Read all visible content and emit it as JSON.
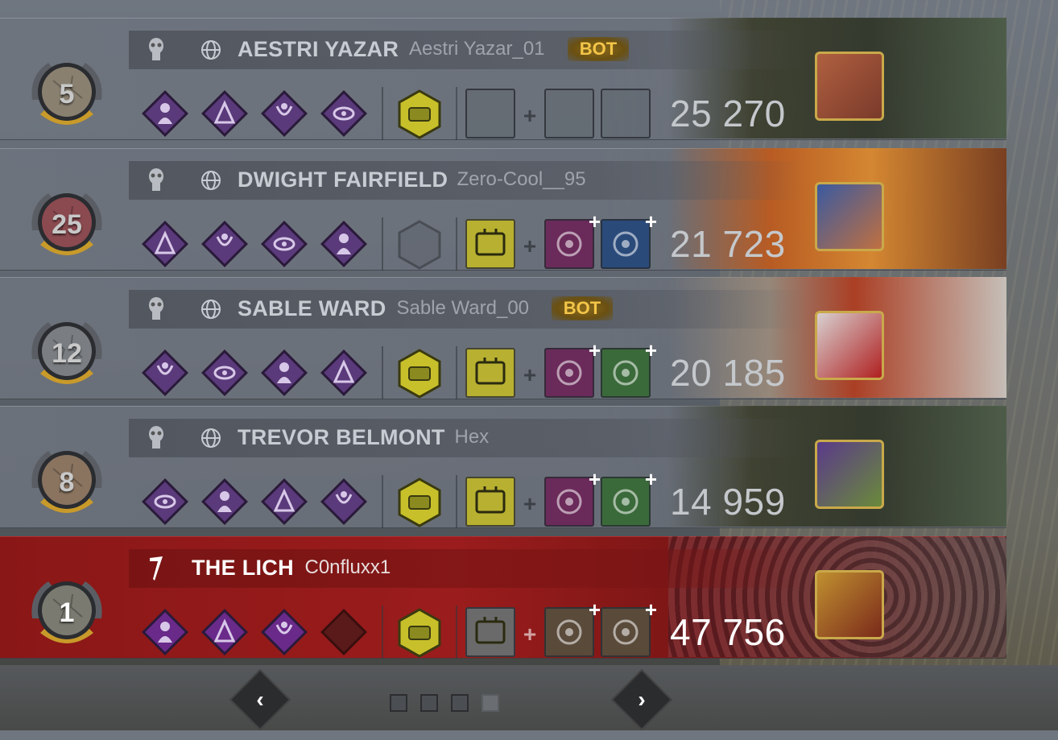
{
  "rows": [
    {
      "role": "survivor",
      "rank": "5",
      "character": "AESTRI YAZAR",
      "handle": "Aestri Yazar_01",
      "bot_label": "BOT",
      "score": "25 270",
      "perks": [
        "perk-icon-1",
        "perk-icon-2",
        "perk-icon-3",
        "perk-icon-4"
      ],
      "offering": "offering-icon",
      "item": "empty",
      "addons": [
        "empty",
        "empty"
      ],
      "portrait": "burning-contraption-portrait",
      "medal_color": "#8a8070"
    },
    {
      "role": "survivor",
      "rank": "25",
      "character": "DWIGHT FAIRFIELD",
      "handle": "Zero-Cool__95",
      "bot_label": "",
      "score": "21 723",
      "perks": [
        "perk-icon-1",
        "perk-icon-2",
        "perk-icon-3",
        "perk-icon-4"
      ],
      "offering": "empty-offering",
      "item": "medkit",
      "addons": [
        "map-addon",
        "bandage-addon"
      ],
      "portrait": "monster-portrait",
      "medal_color": "#8a4a50"
    },
    {
      "role": "survivor",
      "rank": "12",
      "character": "SABLE WARD",
      "handle": "Sable Ward_00",
      "bot_label": "BOT",
      "score": "20 185",
      "perks": [
        "perk-icon-1",
        "perk-icon-2",
        "perk-icon-3",
        "perk-icon-4"
      ],
      "offering": "offering-icon",
      "item": "toolbox",
      "addons": [
        "gear-addon",
        "wire-addon"
      ],
      "portrait": "umbrella-portrait",
      "medal_color": "#7a7e82"
    },
    {
      "role": "survivor",
      "rank": "8",
      "character": "TREVOR BELMONT",
      "handle": "Hex",
      "bot_label": "",
      "score": "14 959",
      "perks": [
        "perk-icon-1",
        "perk-icon-2",
        "perk-icon-3",
        "perk-icon-4"
      ],
      "offering": "offering-icon",
      "item": "toolbox",
      "addons": [
        "gear-addon",
        "cable-addon"
      ],
      "portrait": "plant-monster-portrait",
      "medal_color": "#8a7460"
    },
    {
      "role": "killer",
      "rank": "1",
      "character": "THE LICH",
      "handle": "C0nfluxx1",
      "bot_label": "",
      "score": "47 756",
      "perks": [
        "perk-icon-1",
        "perk-icon-2",
        "perk-icon-3",
        "empty-perk"
      ],
      "offering": "offering-icon",
      "item": "spellbook",
      "addons": [
        "glove-addon",
        "quill-addon"
      ],
      "portrait": "camera-portrait",
      "medal_color": "#7a7a70"
    }
  ],
  "pagination": {
    "pages": 4,
    "active": 3,
    "prev_label": "‹",
    "next_label": "›"
  },
  "colors": {
    "perk_survivor": "#5a3a7a",
    "perk_killer": "#6a2a8a",
    "offering": "#c8c02a",
    "item_yellow": "#b8b030",
    "addon_purple": "#6a2a5a",
    "addon_green": "#3a6a3a",
    "addon_blue": "#2a4a7a",
    "addon_brown": "#5a4a3a"
  }
}
